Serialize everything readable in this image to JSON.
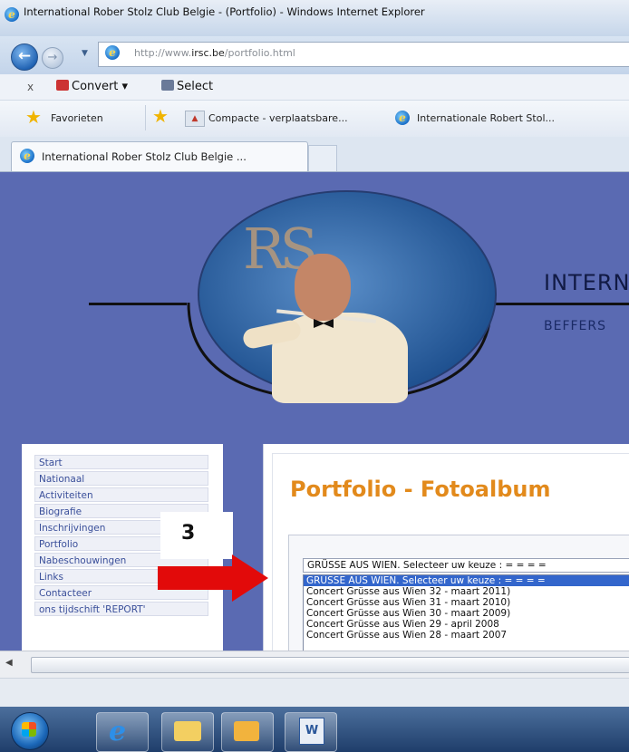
{
  "window": {
    "title": "International Rober Stolz Club Belgie - (Portfolio) - Windows Internet Explorer"
  },
  "address_bar": {
    "url_prefix": "http://www.",
    "url_domain": "irsc.be",
    "url_path": "/portfolio.html"
  },
  "toolbar": {
    "close": "x",
    "convert_label": "Convert ▾",
    "select_label": "Select"
  },
  "favorites_bar": {
    "favorites_label": "Favorieten",
    "links": [
      "Compacte - verplaatsbare...",
      "Internationale Robert Stol..."
    ]
  },
  "tabs": [
    {
      "label": "International Rober Stolz Club Belgie ..."
    }
  ],
  "site_header": {
    "logo_initials": "RS",
    "title_partial": "INTERN",
    "subtitle_partial": "BEFFERS"
  },
  "sidebar": {
    "items": [
      "Start",
      "Nationaal",
      "Activiteiten",
      "Biografie",
      "Inschrijvingen",
      "Portfolio",
      "Nabeschouwingen",
      "Links",
      "Contacteer",
      "ons tijdschift 'REPORT'"
    ]
  },
  "content": {
    "title": "Portfolio - Fotoalbum",
    "select": {
      "current_value": "GRÜSSE AUS WIEN. Selecteer uw keuze :  = = = =",
      "options": [
        "GRÜSSE AUS WIEN. Selecteer uw keuze :  = = = =",
        "Concert Grüsse aus Wien 32 - maart 2011)",
        "Concert Grüsse aus Wien 31 - maart 2010)",
        "Concert Grüsse aus Wien 30 - maart 2009)",
        "Concert Grüsse aus Wien 29 - april 2008",
        "Concert Grüsse aus Wien 28 - maart 2007"
      ],
      "selected_index": 0
    }
  },
  "annotation": {
    "step_number": "3",
    "arrow_color": "#e20a0a"
  },
  "colors": {
    "page_bg": "#5a6ab2",
    "title_orange": "#e28a1c",
    "nav_text": "#3a4f9a",
    "select_highlight": "#3366cc"
  },
  "taskbar": {
    "icons": [
      "start-orb",
      "internet-explorer",
      "windows-explorer",
      "outlook",
      "word"
    ]
  }
}
